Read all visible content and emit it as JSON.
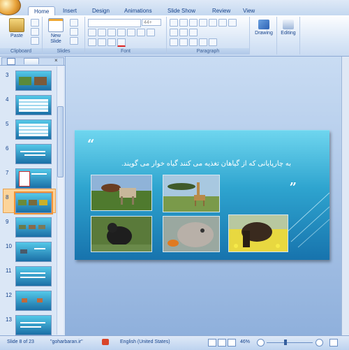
{
  "app": {
    "ribbon_tabs": [
      "Home",
      "Insert",
      "Design",
      "Animations",
      "Slide Show",
      "Review",
      "View"
    ],
    "active_tab": "Home"
  },
  "ribbon": {
    "clipboard": {
      "label": "Clipboard",
      "paste": "Paste"
    },
    "slides": {
      "label": "Slides",
      "new_slide_line1": "New",
      "new_slide_line2": "Slide"
    },
    "font": {
      "label": "Font",
      "size_value": "44+"
    },
    "paragraph": {
      "label": "Paragraph"
    },
    "drawing": {
      "label": "Drawing"
    },
    "editing": {
      "label": "Editing"
    }
  },
  "slide_panel": {
    "thumbnails": [
      {
        "num": "3"
      },
      {
        "num": "4"
      },
      {
        "num": "5"
      },
      {
        "num": "6"
      },
      {
        "num": "7"
      },
      {
        "num": "8"
      },
      {
        "num": "9"
      },
      {
        "num": "10"
      },
      {
        "num": "11"
      },
      {
        "num": "12"
      },
      {
        "num": "13"
      }
    ],
    "selected": "8"
  },
  "slide": {
    "open_quote": "“",
    "close_quote": "„",
    "text": "به چارپایانی که از گیاهان تغذیه می کنند گیاه خوار می گویند."
  },
  "status_bar": {
    "slide_info": "Slide 8 of 23",
    "theme": "\"goharbaran.ir\"",
    "language": "English (United States)",
    "zoom": "46%"
  },
  "colors": {
    "accent_selected": "#f29436",
    "ribbon_text": "#15428b",
    "slide_top": "#6fd6ef",
    "slide_bottom": "#1773ad"
  }
}
